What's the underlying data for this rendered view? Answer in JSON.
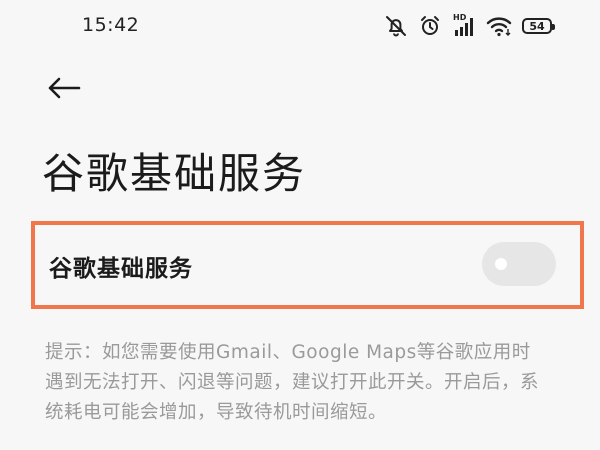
{
  "status_bar": {
    "time": "15:42",
    "icons": [
      "mute-icon",
      "alarm-icon",
      "signal-icon",
      "wifi-icon",
      "battery-icon"
    ],
    "hd_label": "HD",
    "battery_level": "54"
  },
  "nav": {
    "back_icon": "arrow-left-icon"
  },
  "page": {
    "title": "谷歌基础服务"
  },
  "setting": {
    "label": "谷歌基础服务",
    "toggle_state": "off"
  },
  "hint": {
    "text": "提示：如您需要使用Gmail、Google Maps等谷歌应用时遇到无法打开、闪退等问题，建议打开此开关。开启后，系统耗电可能会增加，导致待机时间缩短。"
  },
  "colors": {
    "background": "#f7f7f7",
    "highlight_border": "#f0774c",
    "toggle_off": "#e6e6e6",
    "hint_text": "#9a9a9a"
  }
}
